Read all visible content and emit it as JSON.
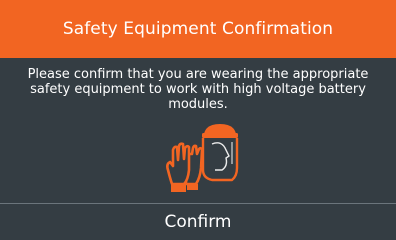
{
  "dialog": {
    "title": "Safety Equipment Confirmation",
    "message": "Please confirm that you are wearing the appropriate safety equipment to work with high voltage battery modules.",
    "confirm_label": "Confirm"
  },
  "icons": {
    "gloves": "safety-gloves-icon",
    "face_shield": "face-shield-icon"
  },
  "colors": {
    "accent": "#f26522",
    "background": "#343d43",
    "text": "#ffffff",
    "divider": "#6b757c"
  }
}
